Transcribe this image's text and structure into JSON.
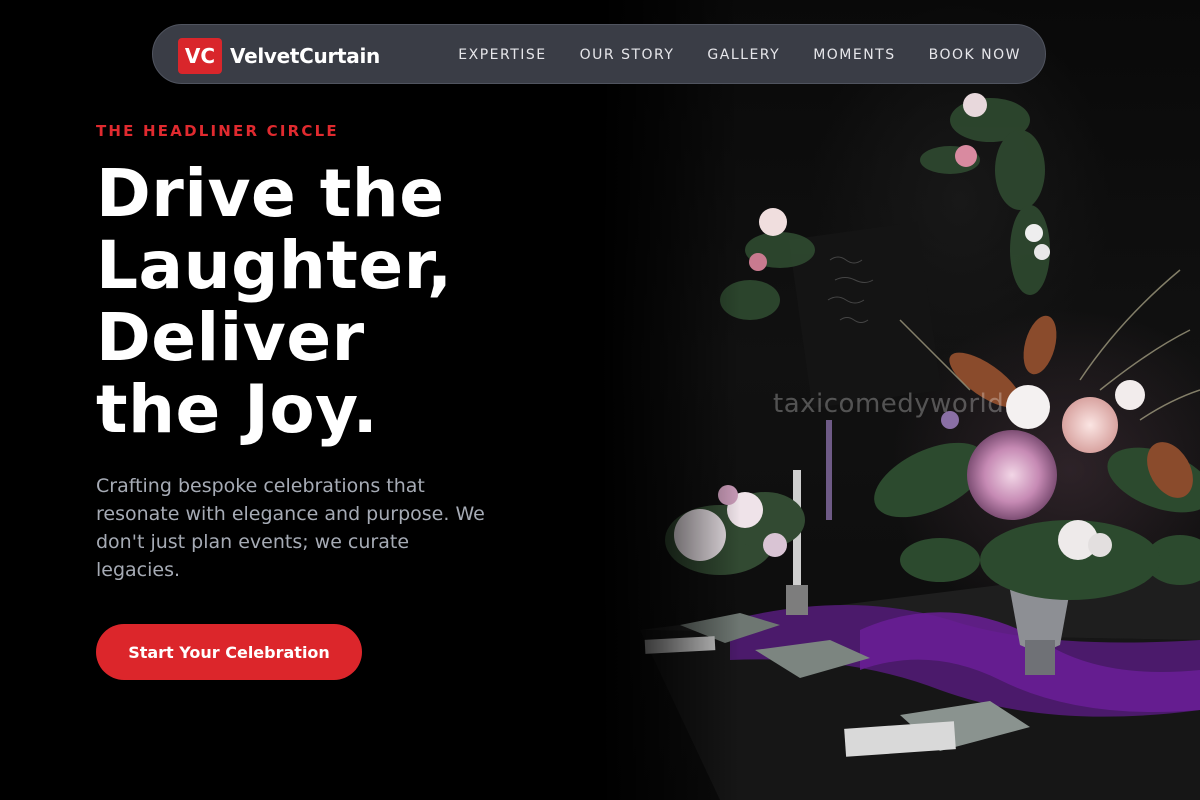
{
  "brand": {
    "badge": "VC",
    "name": "VelvetCurtain",
    "accent_color": "#d9262b"
  },
  "nav": {
    "links": [
      "EXPERTISE",
      "OUR STORY",
      "GALLERY",
      "MOMENTS",
      "BOOK NOW"
    ]
  },
  "hero": {
    "eyebrow": "THE HEADLINER CIRCLE",
    "headline_lines": [
      "Drive the",
      "Laughter,",
      "Deliver",
      "the Joy."
    ],
    "subtext": "Crafting bespoke celebrations that resonate with elegance and purpose. We don't just plan events; we curate legacies.",
    "cta_label": "Start Your Celebration"
  },
  "image": {
    "subject": "floral-table-arrangement",
    "watermark": "taxicomedyworld"
  }
}
